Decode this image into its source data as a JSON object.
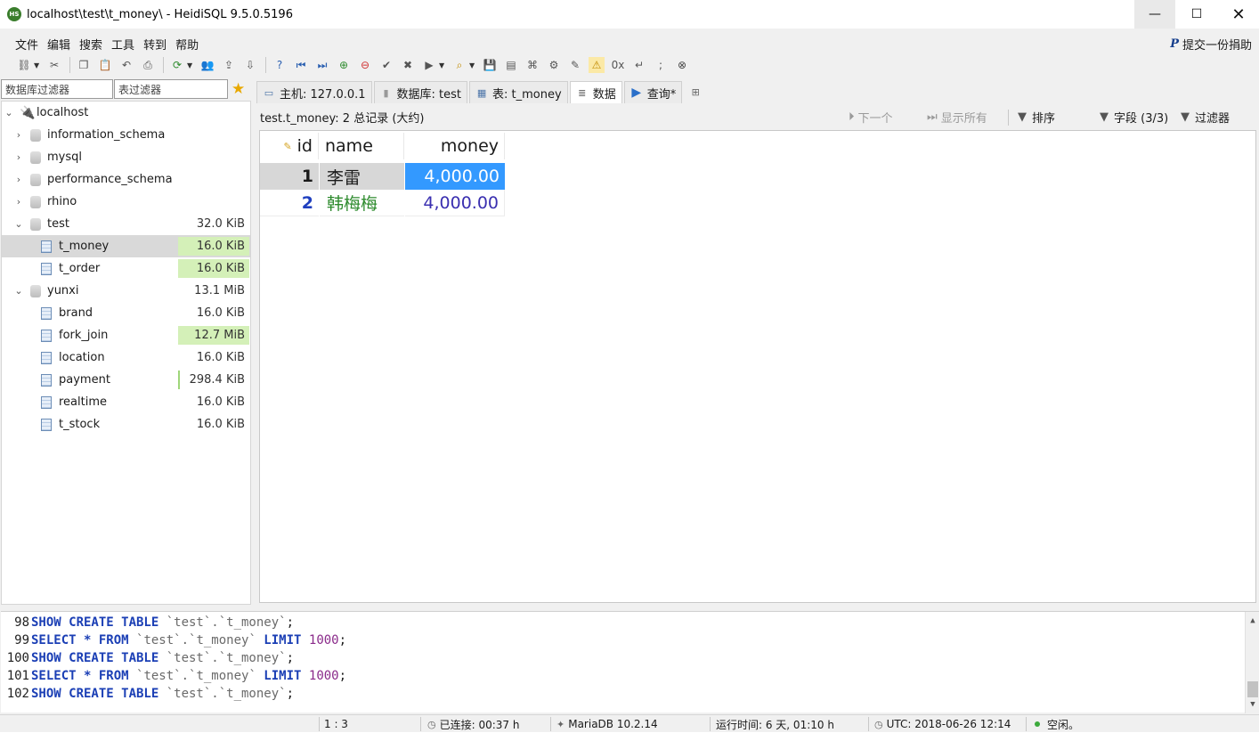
{
  "window": {
    "title": "localhost\\test\\t_money\\ - HeidiSQL 9.5.0.5196",
    "app_icon_text": "HS",
    "min": "—",
    "max": "☐",
    "close": "✕"
  },
  "menu": {
    "items": [
      "文件",
      "编辑",
      "搜索",
      "工具",
      "转到",
      "帮助"
    ],
    "donate": "提交一份捐助",
    "donate_logo": "P"
  },
  "filters": {
    "db_placeholder": "数据库过滤器",
    "table_placeholder": "表过滤器"
  },
  "tree": {
    "host": "localhost",
    "items": [
      {
        "label": "information_schema",
        "type": "db",
        "size": ""
      },
      {
        "label": "mysql",
        "type": "db",
        "size": ""
      },
      {
        "label": "performance_schema",
        "type": "db",
        "size": ""
      },
      {
        "label": "rhino",
        "type": "db",
        "size": ""
      },
      {
        "label": "test",
        "type": "db",
        "size": "32.0 KiB"
      },
      {
        "label": "t_money",
        "type": "table",
        "size": "16.0 KiB"
      },
      {
        "label": "t_order",
        "type": "table",
        "size": "16.0 KiB"
      },
      {
        "label": "yunxi",
        "type": "db",
        "size": "13.1 MiB"
      },
      {
        "label": "brand",
        "type": "table",
        "size": "16.0 KiB"
      },
      {
        "label": "fork_join",
        "type": "table",
        "size": "12.7 MiB"
      },
      {
        "label": "location",
        "type": "table",
        "size": "16.0 KiB"
      },
      {
        "label": "payment",
        "type": "table",
        "size": "298.4 KiB"
      },
      {
        "label": "realtime",
        "type": "table",
        "size": "16.0 KiB"
      },
      {
        "label": "t_stock",
        "type": "table",
        "size": "16.0 KiB"
      }
    ]
  },
  "tabs": [
    {
      "label": "主机: 127.0.0.1"
    },
    {
      "label": "数据库: test"
    },
    {
      "label": "表: t_money"
    },
    {
      "label": "数据"
    },
    {
      "label": "查询*"
    }
  ],
  "databar": {
    "info": "test.t_money: 2 总记录 (大约)",
    "next": "下一个",
    "show_all": "显示所有",
    "sort": "排序",
    "fields": "字段 (3/3)",
    "filter": "过滤器"
  },
  "grid": {
    "columns": [
      "id",
      "name",
      "money"
    ],
    "rows": [
      {
        "id": "1",
        "name": "李雷",
        "money": "4,000.00"
      },
      {
        "id": "2",
        "name": "韩梅梅",
        "money": "4,000.00"
      }
    ]
  },
  "sql_log": [
    {
      "n": "98",
      "pre": "SHOW CREATE TABLE ",
      "mid": "`test`.`t_money`",
      "limit": "",
      "end": ";"
    },
    {
      "n": "99",
      "pre": "SELECT * FROM ",
      "mid": "`test`.`t_money`",
      "limit": "1000",
      "end": ";"
    },
    {
      "n": "100",
      "pre": "SHOW CREATE TABLE ",
      "mid": "`test`.`t_money`",
      "limit": "",
      "end": ";"
    },
    {
      "n": "101",
      "pre": "SELECT * FROM ",
      "mid": "`test`.`t_money`",
      "limit": "1000",
      "end": ";"
    },
    {
      "n": "102",
      "pre": "SHOW CREATE TABLE ",
      "mid": "`test`.`t_money`",
      "limit": "",
      "end": ";"
    }
  ],
  "status": {
    "position": "1 : 3",
    "connected": "已连接: 00:37 h",
    "server": "MariaDB 10.2.14",
    "uptime": "运行时间: 6 天, 01:10 h",
    "utc": "UTC: 2018-06-26 12:14",
    "state": "空闲。"
  },
  "colors": {
    "selection": "#3399ff",
    "row2_id": "#1f3fbf",
    "row2_name": "#2e8b2e",
    "row2_money": "#3a2fb0",
    "size_bar": "#d4f0b8"
  }
}
